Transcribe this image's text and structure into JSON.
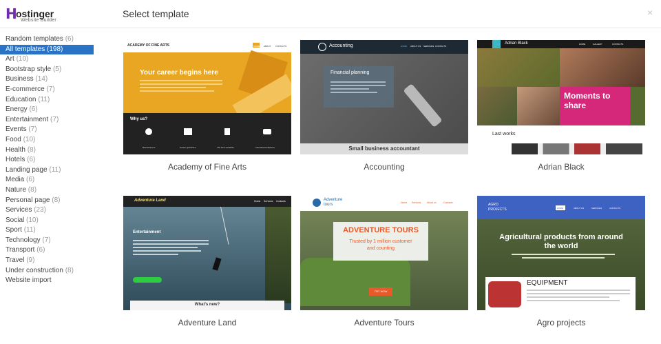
{
  "logo": {
    "word": "ostinger",
    "mark": "H",
    "sub": "Website Builder"
  },
  "header": {
    "title": "Select template",
    "close": "×"
  },
  "categories": [
    {
      "label": "Random templates",
      "count": "(6)"
    },
    {
      "label": "All templates",
      "count": "(198)",
      "active": true
    },
    {
      "label": "Art",
      "count": "(10)"
    },
    {
      "label": "Bootstrap style",
      "count": "(5)"
    },
    {
      "label": "Business",
      "count": "(14)"
    },
    {
      "label": "E-commerce",
      "count": "(7)"
    },
    {
      "label": "Education",
      "count": "(11)"
    },
    {
      "label": "Energy",
      "count": "(6)"
    },
    {
      "label": "Entertainment",
      "count": "(7)"
    },
    {
      "label": "Events",
      "count": "(7)"
    },
    {
      "label": "Food",
      "count": "(10)"
    },
    {
      "label": "Health",
      "count": "(8)"
    },
    {
      "label": "Hotels",
      "count": "(6)"
    },
    {
      "label": "Landing page",
      "count": "(11)"
    },
    {
      "label": "Media",
      "count": "(6)"
    },
    {
      "label": "Nature",
      "count": "(8)"
    },
    {
      "label": "Personal page",
      "count": "(8)"
    },
    {
      "label": "Services",
      "count": "(23)"
    },
    {
      "label": "Social",
      "count": "(10)"
    },
    {
      "label": "Sport",
      "count": "(11)"
    },
    {
      "label": "Technology",
      "count": "(7)"
    },
    {
      "label": "Transport",
      "count": "(6)"
    },
    {
      "label": "Travel",
      "count": "(9)"
    },
    {
      "label": "Under construction",
      "count": "(8)"
    },
    {
      "label": "Website import",
      "count": ""
    }
  ],
  "templates": [
    {
      "name": "Academy of Fine Arts",
      "thumb": {
        "brand": "ACADEMY OF FINE ARTS",
        "headline": "Your career begins here",
        "section": "Why us?",
        "nav": [
          "HOME",
          "ABOUT",
          "CONTACTS"
        ],
        "features": [
          "Best lecturers",
          "Career guarantee",
          "The best social life",
          "International diploma"
        ]
      }
    },
    {
      "name": "Accounting",
      "thumb": {
        "brand": "Accounting",
        "panel": "Financial planning",
        "footer": "Small business accountant",
        "nav": [
          "HOME",
          "ABOUT US",
          "SERVICES",
          "CONTACTS"
        ]
      }
    },
    {
      "name": "Adrian Black",
      "thumb": {
        "brand": "Adrian Black",
        "headline1": "Moments to",
        "headline2": "share",
        "section": "Last works",
        "nav": [
          "HOME",
          "GALLERY",
          "CONTACTS"
        ]
      }
    },
    {
      "name": "Adventure Land",
      "thumb": {
        "brand": "Adventure Land",
        "section": "Entertainment",
        "footer": "What's new?",
        "nav": [
          "Home",
          "Services",
          "Contacts"
        ]
      }
    },
    {
      "name": "Adventure Tours",
      "thumb": {
        "brand": "Adventure",
        "brand2": "tours",
        "headline": "ADVENTURE TOURS",
        "sub1": "Trusted by 1 million customer",
        "sub2": "and counting",
        "button": "TRY NOW",
        "nav": [
          "Home",
          "Services",
          "About us",
          "Contacts"
        ]
      }
    },
    {
      "name": "Agro projects",
      "thumb": {
        "brand": "AGRO",
        "brand2": "PROJECTS",
        "headline1": "Agricultural products from around",
        "headline2": "the world",
        "panel": "EQUIPMENT",
        "nav": [
          "HOME",
          "ABOUT US",
          "SERVICES",
          "CONTACTS"
        ]
      }
    }
  ],
  "colors": {
    "accent": "#2a72c4",
    "brand": "#6f2da8",
    "academy": "#e9a623",
    "tours": "#e85a2a",
    "agro": "#3e62c2",
    "adrian": "#d6287a",
    "land": "#2ecc40"
  }
}
